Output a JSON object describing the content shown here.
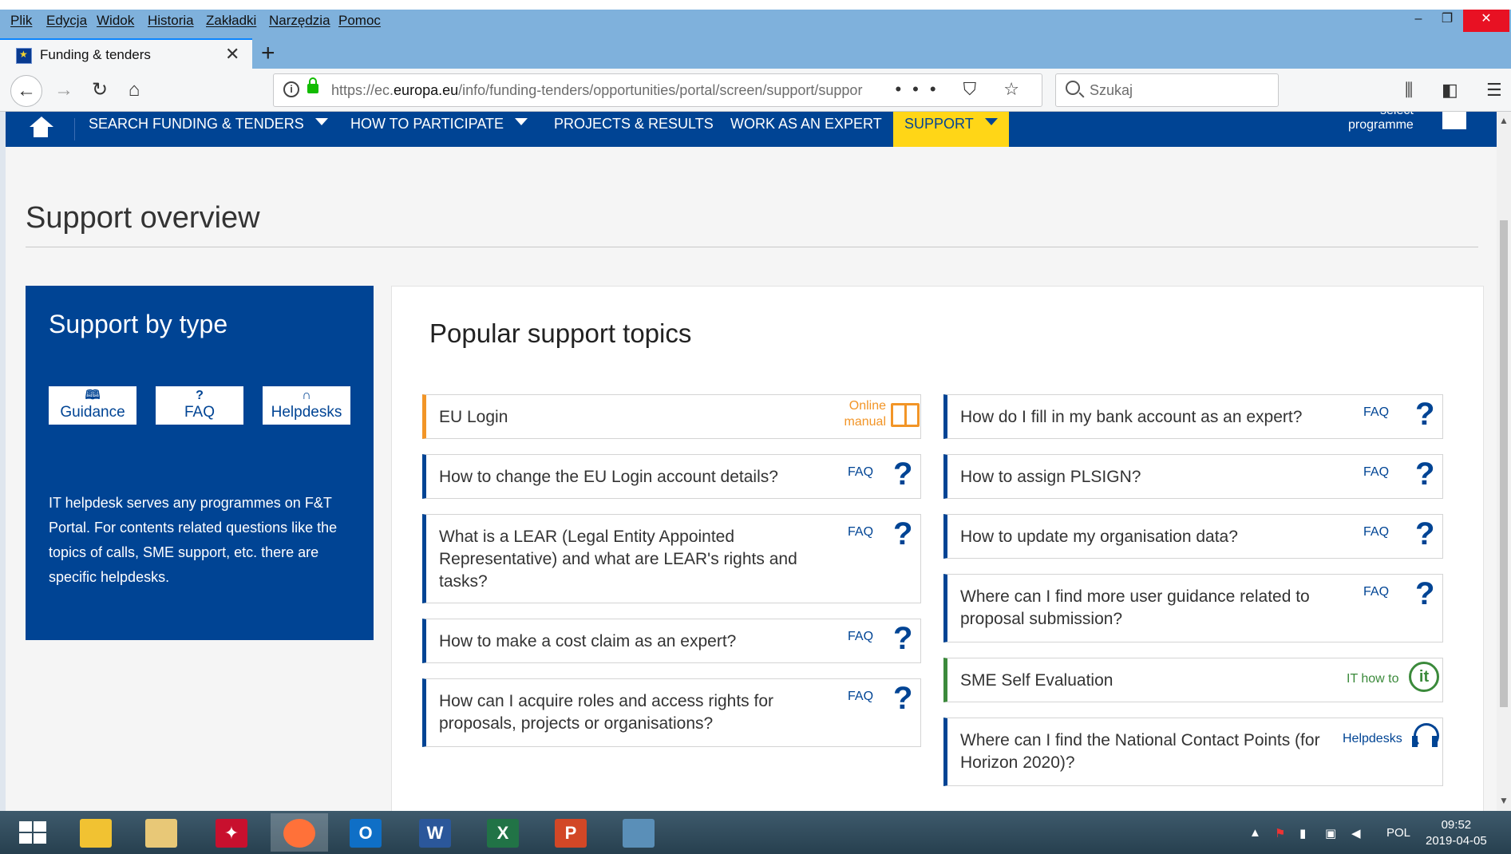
{
  "menubar": {
    "items": [
      "Plik",
      "Edycja",
      "Widok",
      "Historia",
      "Zakładki",
      "Narzędzia",
      "Pomoc"
    ]
  },
  "window_controls": {
    "minimize": "–",
    "restore": "❐",
    "close": "✕"
  },
  "tab": {
    "title": "Funding & tenders",
    "close": "✕",
    "new_tab": "+"
  },
  "navbar": {
    "url_prefix": "https://ec.",
    "url_domain": "europa.eu",
    "url_path": "/info/funding-tenders/opportunities/portal/screen/support/suppor",
    "page_actions": "••• ⛉ ☆",
    "search_placeholder": "Szukaj"
  },
  "site_nav": {
    "items": [
      {
        "label": "SEARCH FUNDING & TENDERS",
        "has_caret": true
      },
      {
        "label": "HOW TO PARTICIPATE",
        "has_caret": true
      },
      {
        "label": "PROJECTS & RESULTS",
        "has_caret": false
      },
      {
        "label": "WORK AS AN EXPERT",
        "has_caret": false
      },
      {
        "label": "SUPPORT",
        "has_caret": true,
        "active": true
      }
    ],
    "select_line1": "select",
    "select_line2": "programme"
  },
  "page": {
    "title": "Support overview",
    "support_by_type": {
      "heading": "Support by type",
      "buttons": [
        {
          "icon": "book-icon",
          "glyph": "🕮",
          "label": "Guidance"
        },
        {
          "icon": "question-icon",
          "glyph": "?",
          "label": "FAQ"
        },
        {
          "icon": "headset-icon",
          "glyph": "∩",
          "label": "Helpdesks"
        }
      ],
      "description": "IT helpdesk serves any programmes on F&T Portal. For contents related questions like the topics of calls, SME support, etc. there are specific helpdesks."
    },
    "popular": {
      "heading": "Popular support topics",
      "left": [
        {
          "text": "EU Login",
          "tag": "Online manual",
          "kind": "manual"
        },
        {
          "text": "How to change the EU Login account details?",
          "tag": "FAQ",
          "kind": "faq"
        },
        {
          "text": "What is a LEAR (Legal Entity Appointed Representative) and what are LEAR's rights and tasks?",
          "tag": "FAQ",
          "kind": "faq"
        },
        {
          "text": "How to make a cost claim as an expert?",
          "tag": "FAQ",
          "kind": "faq"
        },
        {
          "text": "How can I acquire roles and access rights for proposals, projects or organisations?",
          "tag": "FAQ",
          "kind": "faq"
        }
      ],
      "right": [
        {
          "text": "How do I fill in my bank account as an expert?",
          "tag": "FAQ",
          "kind": "faq"
        },
        {
          "text": "How to assign PLSIGN?",
          "tag": "FAQ",
          "kind": "faq"
        },
        {
          "text": "How to update my organisation data?",
          "tag": "FAQ",
          "kind": "faq"
        },
        {
          "text": "Where can I find more user guidance related to proposal submission?",
          "tag": "FAQ",
          "kind": "faq"
        },
        {
          "text": "SME Self Evaluation",
          "tag": "IT how to",
          "kind": "it"
        },
        {
          "text": "Where can I find the National Contact Points (for Horizon 2020)?",
          "tag": "Helpdesks",
          "kind": "helpdesk"
        }
      ]
    }
  },
  "colors": {
    "ec_blue": "#004494",
    "support_yellow": "#ffd617",
    "manual_orange": "#f29527",
    "it_green": "#3b8a3b"
  },
  "taskbar": {
    "apps": [
      {
        "name": "file-explorer",
        "label": ""
      },
      {
        "name": "folder",
        "label": ""
      },
      {
        "name": "acrobat",
        "label": ""
      },
      {
        "name": "firefox",
        "label": ""
      },
      {
        "name": "outlook",
        "label": "O"
      },
      {
        "name": "word",
        "label": "W"
      },
      {
        "name": "excel",
        "label": "X"
      },
      {
        "name": "powerpoint",
        "label": "P"
      },
      {
        "name": "image-viewer",
        "label": ""
      }
    ],
    "language": "POL",
    "time": "09:52",
    "date": "2019-04-05"
  }
}
